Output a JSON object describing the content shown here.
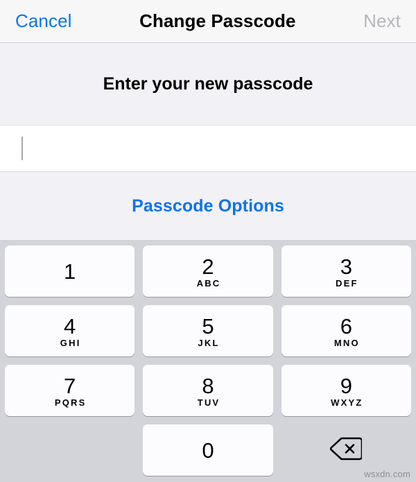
{
  "navbar": {
    "cancel_label": "Cancel",
    "title": "Change Passcode",
    "next_label": "Next"
  },
  "prompt": {
    "text": "Enter your new passcode"
  },
  "passcode_field": {
    "value": "",
    "placeholder": ""
  },
  "options": {
    "label": "Passcode Options"
  },
  "keypad": {
    "rows": [
      [
        {
          "digit": "1",
          "letters": ""
        },
        {
          "digit": "2",
          "letters": "ABC"
        },
        {
          "digit": "3",
          "letters": "DEF"
        }
      ],
      [
        {
          "digit": "4",
          "letters": "GHI"
        },
        {
          "digit": "5",
          "letters": "JKL"
        },
        {
          "digit": "6",
          "letters": "MNO"
        }
      ],
      [
        {
          "digit": "7",
          "letters": "PQRS"
        },
        {
          "digit": "8",
          "letters": "TUV"
        },
        {
          "digit": "9",
          "letters": "WXYZ"
        }
      ],
      [
        {
          "digit": "",
          "letters": ""
        },
        {
          "digit": "0",
          "letters": ""
        },
        {
          "digit": "delete-icon",
          "letters": ""
        }
      ]
    ]
  },
  "watermark": {
    "text": "wsxdn.com"
  },
  "colors": {
    "accent_blue": "#0a74ec",
    "disabled_gray": "#b6b6bb",
    "keypad_background": "#d2d4da",
    "key_face": "#fcfcfe",
    "panel_background": "#f2f1f6",
    "navbar_background": "#f7f7f7"
  }
}
